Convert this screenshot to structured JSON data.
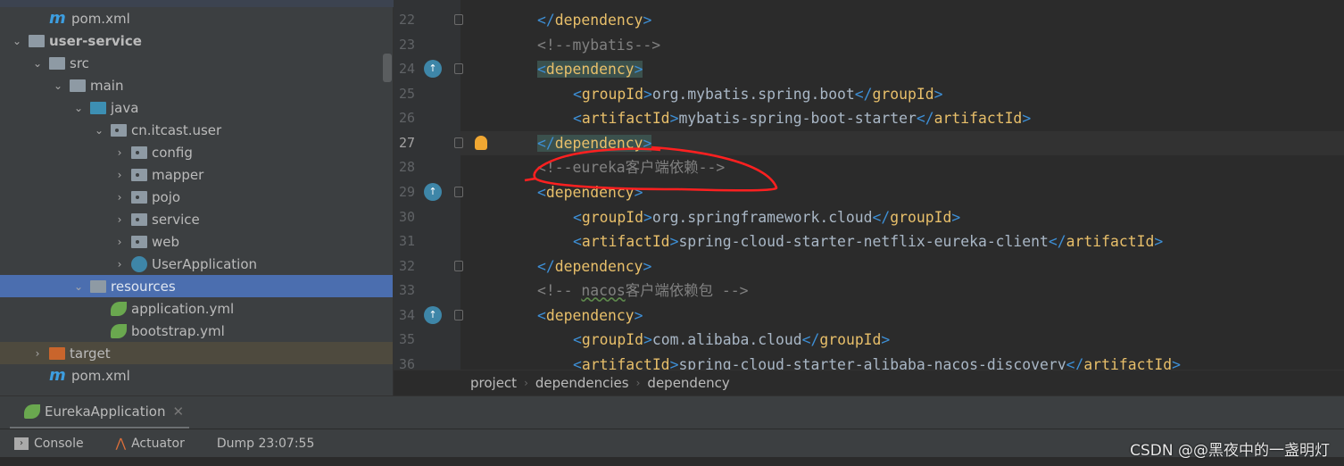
{
  "tree": [
    {
      "label": "pom.xml",
      "icon": "maven-icon",
      "depth": 1,
      "chev": ""
    },
    {
      "label": "user-service",
      "icon": "module-folder-icon",
      "depth": 0,
      "chev": "down",
      "bold": true
    },
    {
      "label": "src",
      "icon": "folder-icon",
      "depth": 1,
      "chev": "down"
    },
    {
      "label": "main",
      "icon": "folder-icon",
      "depth": 2,
      "chev": "down"
    },
    {
      "label": "java",
      "icon": "source-folder-icon",
      "depth": 3,
      "chev": "down"
    },
    {
      "label": "cn.itcast.user",
      "icon": "package-icon",
      "depth": 4,
      "chev": "down"
    },
    {
      "label": "config",
      "icon": "package-icon",
      "depth": 5,
      "chev": "right"
    },
    {
      "label": "mapper",
      "icon": "package-icon",
      "depth": 5,
      "chev": "right"
    },
    {
      "label": "pojo",
      "icon": "package-icon",
      "depth": 5,
      "chev": "right"
    },
    {
      "label": "service",
      "icon": "package-icon",
      "depth": 5,
      "chev": "right"
    },
    {
      "label": "web",
      "icon": "package-icon",
      "depth": 5,
      "chev": "right"
    },
    {
      "label": "UserApplication",
      "icon": "spring-boot-app-icon",
      "depth": 5,
      "chev": "right"
    },
    {
      "label": "resources",
      "icon": "resources-folder-icon",
      "depth": 3,
      "chev": "down",
      "selected": true
    },
    {
      "label": "application.yml",
      "icon": "spring-config-icon",
      "depth": 4,
      "chev": ""
    },
    {
      "label": "bootstrap.yml",
      "icon": "spring-config-icon",
      "depth": 4,
      "chev": ""
    },
    {
      "label": "target",
      "icon": "excluded-folder-icon",
      "depth": 1,
      "chev": "right",
      "excluded": true
    },
    {
      "label": "pom.xml",
      "icon": "maven-icon",
      "depth": 1,
      "chev": ""
    }
  ],
  "code": [
    {
      "n": "22",
      "i": 0,
      "parts": [
        [
          "b",
          "</"
        ],
        [
          "t",
          "dependency"
        ],
        [
          "b",
          ">"
        ]
      ],
      "fold": true
    },
    {
      "n": "23",
      "i": 0,
      "parts": [
        [
          "c",
          "<!--mybatis-->"
        ]
      ]
    },
    {
      "n": "24",
      "i": 0,
      "parts": [
        [
          "b",
          "<"
        ],
        [
          "t",
          "dependency"
        ],
        [
          "b",
          ">"
        ]
      ],
      "hl": true,
      "gicon": true,
      "fold": true
    },
    {
      "n": "25",
      "i": 1,
      "parts": [
        [
          "b",
          "<"
        ],
        [
          "t",
          "groupId"
        ],
        [
          "b",
          ">"
        ],
        [
          "x",
          "org.mybatis.spring.boot"
        ],
        [
          "b",
          "</"
        ],
        [
          "t",
          "groupId"
        ],
        [
          "b",
          ">"
        ]
      ]
    },
    {
      "n": "26",
      "i": 1,
      "parts": [
        [
          "b",
          "<"
        ],
        [
          "t",
          "artifactId"
        ],
        [
          "b",
          ">"
        ],
        [
          "x",
          "mybatis-spring-boot-starter"
        ],
        [
          "b",
          "</"
        ],
        [
          "t",
          "artifactId"
        ],
        [
          "b",
          ">"
        ]
      ]
    },
    {
      "n": "27",
      "i": 0,
      "parts": [
        [
          "b",
          "</"
        ],
        [
          "t",
          "dependency"
        ],
        [
          "b",
          ">"
        ]
      ],
      "hl": true,
      "cur": true,
      "bulb": true,
      "fold": true
    },
    {
      "n": "28",
      "i": 0,
      "parts": [
        [
          "c",
          "<!--eureka客户端依赖-->"
        ]
      ]
    },
    {
      "n": "29",
      "i": 0,
      "parts": [
        [
          "b",
          "<"
        ],
        [
          "t",
          "dependency"
        ],
        [
          "b",
          ">"
        ]
      ],
      "gicon": true,
      "fold": true
    },
    {
      "n": "30",
      "i": 1,
      "parts": [
        [
          "b",
          "<"
        ],
        [
          "t",
          "groupId"
        ],
        [
          "b",
          ">"
        ],
        [
          "x",
          "org.springframework.cloud"
        ],
        [
          "b",
          "</"
        ],
        [
          "t",
          "groupId"
        ],
        [
          "b",
          ">"
        ]
      ]
    },
    {
      "n": "31",
      "i": 1,
      "parts": [
        [
          "b",
          "<"
        ],
        [
          "t",
          "artifactId"
        ],
        [
          "b",
          ">"
        ],
        [
          "x",
          "spring-cloud-starter-netflix-eureka-client"
        ],
        [
          "b",
          "</"
        ],
        [
          "t",
          "artifactId"
        ],
        [
          "b",
          ">"
        ]
      ]
    },
    {
      "n": "32",
      "i": 0,
      "parts": [
        [
          "b",
          "</"
        ],
        [
          "t",
          "dependency"
        ],
        [
          "b",
          ">"
        ]
      ],
      "fold": true
    },
    {
      "n": "33",
      "i": 0,
      "parts": [
        [
          "c",
          "<!-- "
        ],
        [
          "cw",
          "nacos"
        ],
        [
          "c",
          "客户端依赖包 -->"
        ]
      ]
    },
    {
      "n": "34",
      "i": 0,
      "parts": [
        [
          "b",
          "<"
        ],
        [
          "t",
          "dependency"
        ],
        [
          "b",
          ">"
        ]
      ],
      "gicon": true,
      "fold": true
    },
    {
      "n": "35",
      "i": 1,
      "parts": [
        [
          "b",
          "<"
        ],
        [
          "t",
          "groupId"
        ],
        [
          "b",
          ">"
        ],
        [
          "x",
          "com.alibaba.cloud"
        ],
        [
          "b",
          "</"
        ],
        [
          "t",
          "groupId"
        ],
        [
          "b",
          ">"
        ]
      ]
    },
    {
      "n": "36",
      "i": 1,
      "parts": [
        [
          "b",
          "<"
        ],
        [
          "t",
          "artifactId"
        ],
        [
          "b",
          ">"
        ],
        [
          "x",
          "spring-cloud-starter-alibaba-nacos-discovery"
        ],
        [
          "b",
          "</"
        ],
        [
          "t",
          "artifactId"
        ],
        [
          "b",
          ">"
        ]
      ]
    }
  ],
  "breadcrumb": [
    "project",
    "dependencies",
    "dependency"
  ],
  "run_tab": {
    "label": "EurekaApplication",
    "icon": "spring-boot-app-icon"
  },
  "toolbar": {
    "console": "Console",
    "actuator": "Actuator",
    "dump": "Dump 23:07:55"
  },
  "watermark": "CSDN @@黑夜中的一盏明灯",
  "colors": {
    "tag": "#e8bf6a",
    "bracket": "#3d8fd6",
    "comment": "#808080",
    "selection": "#4b6eaf",
    "annotation": "#ff2020"
  }
}
